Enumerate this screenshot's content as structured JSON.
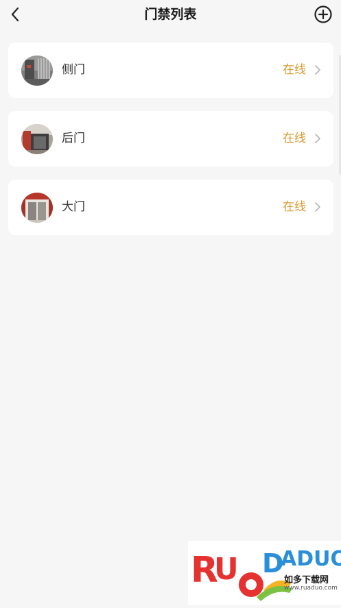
{
  "header": {
    "title": "门禁列表",
    "back_icon": "chevron-left-icon",
    "add_icon": "plus-circle-icon"
  },
  "doors": [
    {
      "name": "侧门",
      "status": "在线",
      "avatar": "door-photo-side"
    },
    {
      "name": "后门",
      "status": "在线",
      "avatar": "door-photo-back"
    },
    {
      "name": "大门",
      "status": "在线",
      "avatar": "door-photo-main"
    }
  ],
  "colors": {
    "background": "#f6f6f6",
    "card": "#ffffff",
    "status_online": "#d99a2b",
    "title": "#1c1c1c"
  },
  "watermark": {
    "brand": "RUODADUO",
    "subtitle": "如多下载网",
    "url": "www.ruaduo.com"
  }
}
